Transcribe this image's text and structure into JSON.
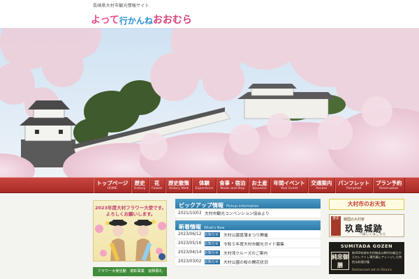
{
  "header": {
    "tagline": "長崎県大村市観光情報サイト",
    "logo": [
      "よって",
      "行かんね",
      "おおむら"
    ]
  },
  "nav": [
    {
      "jp": "トップページ",
      "en": "HOME"
    },
    {
      "jp": "歴史",
      "en": "History"
    },
    {
      "jp": "花",
      "en": "Flower"
    },
    {
      "jp": "歴史散策",
      "en": "History Walk"
    },
    {
      "jp": "体験",
      "en": "Experience"
    },
    {
      "jp": "食事・宿泊",
      "en": "Meals and Stay"
    },
    {
      "jp": "お土産",
      "en": "Souvenir"
    },
    {
      "jp": "年間イベント",
      "en": "Year Event"
    },
    {
      "jp": "交通案内",
      "en": "Access"
    },
    {
      "jp": "パンフレット",
      "en": "Pamphlet"
    },
    {
      "jp": "プラン予約",
      "en": "Reservation"
    }
  ],
  "banner": {
    "line1": "2023年度大村フラワー大使です。",
    "line2": "よろしくお願いします。"
  },
  "ambassador_links": "フラワー大使活動　選彰事業　協賛募礼",
  "pickup": {
    "title_jp": "ピックアップ情報",
    "title_en": "Pickup information",
    "items": [
      {
        "date": "2021/10/03",
        "title": "大村市観光コンベンション協会より"
      }
    ]
  },
  "news": {
    "title_jp": "新着情報",
    "title_en": "What's New",
    "items": [
      {
        "date": "2023/06/12",
        "cat": "お知らせ",
        "title": "大村公園菖蒲まつり開催"
      },
      {
        "date": "2023/05/16",
        "cat": "お知らせ",
        "title": "令和５年度大村市観光ガイド募集"
      },
      {
        "date": "2023/04/14",
        "cat": "お知らせ",
        "title": "大村湾クルーズのご案内"
      },
      {
        "date": "2023/03/02",
        "cat": "お知らせ",
        "title": "大村公園の桜の開花状況"
      }
    ]
  },
  "weather": {
    "label": "大村市のお天気"
  },
  "castle_banner": {
    "side": "歴史",
    "sub": "戦国の大村家",
    "name": "玖島城跡",
    "more": "～詳しくはこちら"
  },
  "sumitada_banner": {
    "title": "SUMITADA GOZEN",
    "mark": "純忠御膳",
    "desc": "約450年前の大村純忠公時代の献立からセレクトし現代風にアレンジした特別な料理が楽",
    "en": "Restaurant set in Omura"
  },
  "colors": {
    "nav": "#b5352f",
    "section_head": "#3a88b8",
    "weather_text": "#c43c2b"
  }
}
